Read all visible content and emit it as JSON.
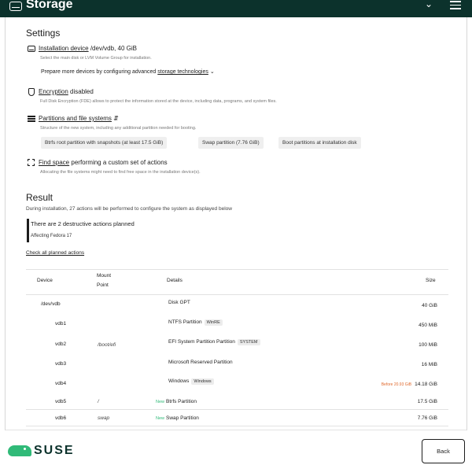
{
  "header": {
    "title": "Storage"
  },
  "settings": {
    "heading": "Settings",
    "install_device": {
      "label": "Installation device",
      "value": "/dev/vdb, 40 GiB",
      "desc": "Select the main disk or LVM Volume Group for installation."
    },
    "prepare": {
      "text": "Prepare more devices by configuring advanced",
      "link": "storage technologies"
    },
    "encryption": {
      "label": "Encryption",
      "value": "disabled",
      "desc": "Full Disk Encryption (FDE) allows to protect the information stored at the device, including data, programs, and system files."
    },
    "partitions": {
      "label": "Partitions and file systems",
      "desc": "Structure of the new system, including any additional partition needed for booting.",
      "chips": [
        "Btrfs root partition with snapshots (at least 17.5 GiB)",
        "Swap partition (7.76 GiB)",
        "Boot partitions at installation disk"
      ]
    },
    "find_space": {
      "label": "Find space",
      "value": "performing a custom set of actions",
      "desc": "Allocating the file systems might need to find free space in the installation device(s)."
    }
  },
  "result": {
    "heading": "Result",
    "text": "During installation, 27 actions will be performed to configure the system as displayed below",
    "alert_title": "There are 2 destructive actions planned",
    "alert_sub": "Affecting Fedora 17",
    "check_link": "Check all planned actions"
  },
  "table": {
    "headers": {
      "device": "Device",
      "mount1": "Mount",
      "mount2": "Point",
      "details": "Details",
      "size": "Size"
    },
    "rows": [
      {
        "device": "/dev/vdb",
        "mount": "",
        "new": "",
        "details": "Disk",
        "badge": "GPT",
        "before": "",
        "size": "40 GiB"
      },
      {
        "device": "vdb1",
        "mount": "",
        "new": "",
        "details": "NTFS Partition",
        "badge": "WinRE",
        "before": "",
        "size": "450 MiB"
      },
      {
        "device": "vdb2",
        "mount": "/boot/efi",
        "new": "",
        "details": "EFI System Partition Partition",
        "badge": "SYSTEM",
        "before": "",
        "size": "100 MiB"
      },
      {
        "device": "vdb3",
        "mount": "",
        "new": "",
        "details": "Microsoft Reserved Partition",
        "badge": "",
        "before": "",
        "size": "16 MiB"
      },
      {
        "device": "vdb4",
        "mount": "",
        "new": "",
        "details": "Windows",
        "badge": "Windows",
        "before": "Before 20.93 GiB",
        "size": "14.18 GiB"
      },
      {
        "device": "vdb5",
        "mount": "/",
        "new": "New",
        "details": "Btrfs Partition",
        "badge": "",
        "before": "",
        "size": "17.5 GiB"
      },
      {
        "device": "vdb6",
        "mount": "swap",
        "new": "New",
        "details": "Swap Partition",
        "badge": "",
        "before": "",
        "size": "7.76 GiB"
      }
    ]
  },
  "footer": {
    "brand": "SUSE",
    "back_label": "Back"
  }
}
